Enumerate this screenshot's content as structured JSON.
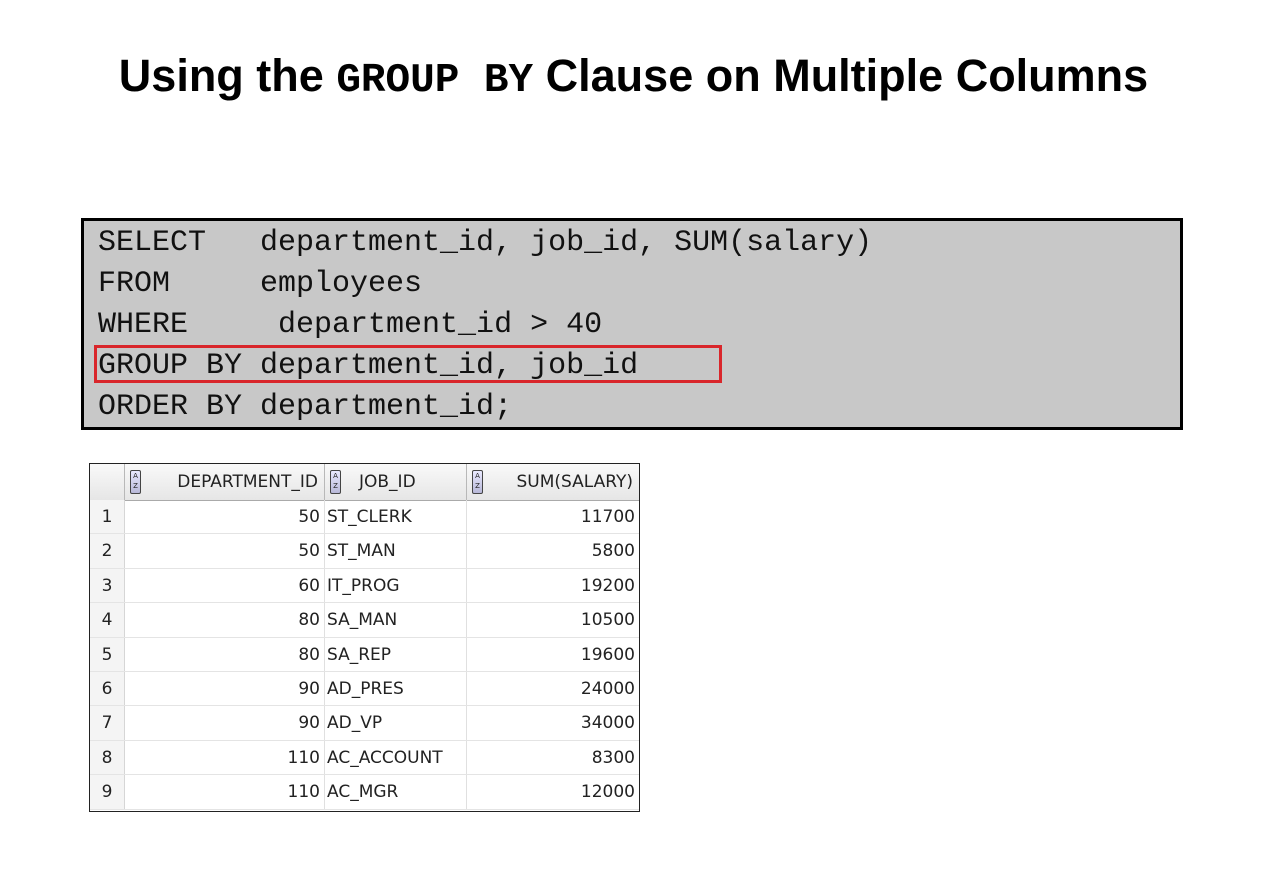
{
  "title": {
    "part1": "Using the ",
    "mono": "GROUP BY",
    "part2": " Clause on Multiple Columns"
  },
  "sql": {
    "lines": [
      "SELECT   department_id, job_id, SUM(salary)",
      "FROM     employees",
      "WHERE     department_id > 40",
      "GROUP BY department_id, job_id",
      "ORDER BY department_id;"
    ],
    "highlight_color": "#d9262b"
  },
  "grid": {
    "columns": [
      "DEPARTMENT_ID",
      "JOB_ID",
      "SUM(SALARY)"
    ],
    "sort_icon": "sort-az-icon",
    "rows": [
      {
        "n": "1",
        "dept": "50",
        "job": "ST_CLERK",
        "sum": "11700"
      },
      {
        "n": "2",
        "dept": "50",
        "job": "ST_MAN",
        "sum": "5800"
      },
      {
        "n": "3",
        "dept": "60",
        "job": "IT_PROG",
        "sum": "19200"
      },
      {
        "n": "4",
        "dept": "80",
        "job": "SA_MAN",
        "sum": "10500"
      },
      {
        "n": "5",
        "dept": "80",
        "job": "SA_REP",
        "sum": "19600"
      },
      {
        "n": "6",
        "dept": "90",
        "job": "AD_PRES",
        "sum": "24000"
      },
      {
        "n": "7",
        "dept": "90",
        "job": "AD_VP",
        "sum": "34000"
      },
      {
        "n": "8",
        "dept": "110",
        "job": "AC_ACCOUNT",
        "sum": "8300"
      },
      {
        "n": "9",
        "dept": "110",
        "job": "AC_MGR",
        "sum": "12000"
      }
    ]
  }
}
